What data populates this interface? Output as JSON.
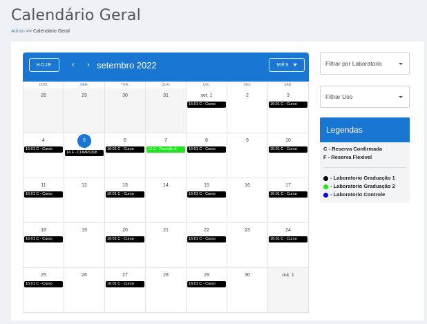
{
  "page": {
    "title": "Calendário Geral",
    "breadcrumb_link": "Admin",
    "breadcrumb_sep": ">>",
    "breadcrumb_current": "Calendário Geral"
  },
  "calendar": {
    "today_label": "HOJE",
    "prev_icon": "‹",
    "next_icon": "›",
    "title": "setembro 2022",
    "view_label": "MÊS",
    "weekdays": [
      "DOM.",
      "SEG.",
      "TER.",
      "QUA.",
      "QUI.",
      "SEX.",
      "SÁB."
    ],
    "colors": {
      "toolbar": "#1976d2",
      "event": "#000000",
      "event_green": "#22e422"
    },
    "weeks": [
      [
        {
          "day": "28",
          "out": true,
          "events": []
        },
        {
          "day": "29",
          "out": true,
          "events": []
        },
        {
          "day": "30",
          "out": true,
          "events": []
        },
        {
          "day": "31",
          "out": true,
          "events": []
        },
        {
          "day": "set. 1",
          "events": [
            {
              "text": "16:01 C - Curso"
            }
          ]
        },
        {
          "day": "2",
          "events": []
        },
        {
          "day": "3",
          "events": [
            {
              "text": "16:01 C - Curso"
            }
          ]
        }
      ],
      [
        {
          "day": "4",
          "events": [
            {
              "text": "16:01 C - Curso"
            }
          ]
        },
        {
          "day": "5",
          "today": true,
          "events": [
            {
              "text": "14 F - COMP0308"
            }
          ]
        },
        {
          "day": "6",
          "events": [
            {
              "text": "16:01 C - Curso"
            }
          ]
        },
        {
          "day": "7",
          "events": [
            {
              "text": "12 C - Reunião d",
              "color": "green"
            }
          ]
        },
        {
          "day": "8",
          "events": [
            {
              "text": "16:01 C - Curso"
            }
          ]
        },
        {
          "day": "9",
          "events": []
        },
        {
          "day": "10",
          "events": [
            {
              "text": "16:01 C - Curso"
            }
          ]
        }
      ],
      [
        {
          "day": "11",
          "events": [
            {
              "text": "16:01 C - Curso"
            }
          ]
        },
        {
          "day": "12",
          "events": []
        },
        {
          "day": "13",
          "events": [
            {
              "text": "16:01 C - Curso"
            }
          ]
        },
        {
          "day": "14",
          "events": []
        },
        {
          "day": "15",
          "events": [
            {
              "text": "16:01 C - Curso"
            }
          ]
        },
        {
          "day": "16",
          "events": []
        },
        {
          "day": "17",
          "events": [
            {
              "text": "16:01 C - Curso"
            }
          ]
        }
      ],
      [
        {
          "day": "18",
          "events": [
            {
              "text": "16:01 C - Curso"
            }
          ]
        },
        {
          "day": "19",
          "events": []
        },
        {
          "day": "20",
          "events": [
            {
              "text": "16:01 C - Curso"
            }
          ]
        },
        {
          "day": "21",
          "events": []
        },
        {
          "day": "22",
          "events": [
            {
              "text": "16:01 C - Curso"
            }
          ]
        },
        {
          "day": "23",
          "events": []
        },
        {
          "day": "24",
          "events": [
            {
              "text": "16:01 C - Curso"
            }
          ]
        }
      ],
      [
        {
          "day": "25",
          "events": [
            {
              "text": "16:01 C - Curso"
            }
          ]
        },
        {
          "day": "26",
          "events": []
        },
        {
          "day": "27",
          "events": [
            {
              "text": "16:01 C - Curso"
            }
          ]
        },
        {
          "day": "28",
          "events": []
        },
        {
          "day": "29",
          "events": [
            {
              "text": "16:01 C - Curso"
            }
          ]
        },
        {
          "day": "30",
          "events": []
        },
        {
          "day": "out. 1",
          "out": true,
          "events": []
        }
      ]
    ]
  },
  "sidebar": {
    "filter_lab_placeholder": "Filtrar por Laboratorio",
    "filter_use_placeholder": "Filtrar Uso",
    "legend_title": "Legendas",
    "legend_types": [
      "C - Reserva Confirmada",
      "F - Reserva Flexivel"
    ],
    "legend_labs": [
      {
        "label": "- Laboratorio Graduação 1",
        "color": "#000000"
      },
      {
        "label": "- Laboratorio Graduação 2",
        "color": "#22e422"
      },
      {
        "label": "- Laboratorio Controle",
        "color": "#0000dd"
      }
    ]
  }
}
